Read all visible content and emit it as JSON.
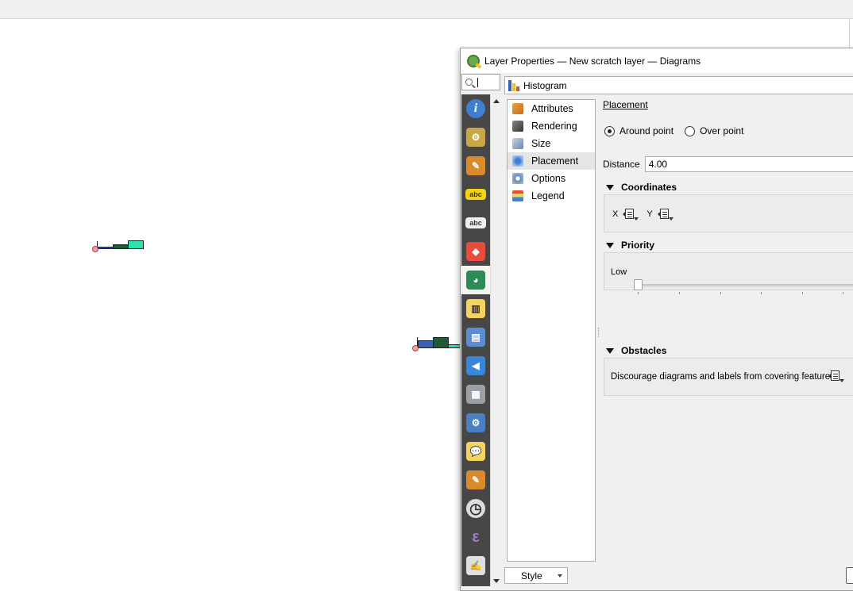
{
  "dialog": {
    "title": "Layer Properties — New scratch layer — Diagrams",
    "search_value": "",
    "diagram_type": "Histogram",
    "style_button": "Style"
  },
  "sidebar_icons": [
    {
      "name": "information-icon",
      "glyph": "i",
      "color": "#3f7fcf"
    },
    {
      "name": "source-icon",
      "glyph": "⚙",
      "color": "#c9a648"
    },
    {
      "name": "symbology-icon",
      "glyph": "✎",
      "color": "#d98b2b"
    },
    {
      "name": "labels-icon",
      "glyph": "abc",
      "color": "#f5d215"
    },
    {
      "name": "masks-icon",
      "glyph": "abc",
      "color": "#eeeeee"
    },
    {
      "name": "3d-view-icon",
      "glyph": "◆",
      "color": "#e94b3c"
    },
    {
      "name": "diagrams-icon",
      "glyph": "◕",
      "color": "#2e8b57"
    },
    {
      "name": "fields-icon",
      "glyph": "▥",
      "color": "#f4d35e"
    },
    {
      "name": "attributes-form-icon",
      "glyph": "▤",
      "color": "#5b8dcf"
    },
    {
      "name": "joins-icon",
      "glyph": "◀",
      "color": "#3a86d9"
    },
    {
      "name": "auxiliary-storage-icon",
      "glyph": "▦",
      "color": "#9aa0a6"
    },
    {
      "name": "actions-icon",
      "glyph": "⚙",
      "color": "#4a7fc1"
    },
    {
      "name": "display-icon",
      "glyph": "💬",
      "color": "#f4d35e"
    },
    {
      "name": "rendering-icon",
      "glyph": "✎",
      "color": "#d98b2b"
    },
    {
      "name": "temporal-icon",
      "glyph": "◷",
      "color": "#dddddd"
    },
    {
      "name": "variables-icon",
      "glyph": "ε",
      "color": "#7b4a9e"
    },
    {
      "name": "metadata-icon",
      "glyph": "✍",
      "color": "#e0e0e0"
    }
  ],
  "subnav": [
    {
      "label": "Attributes",
      "icon": "attributes-brush-icon"
    },
    {
      "label": "Rendering",
      "icon": "rendering-brush-icon"
    },
    {
      "label": "Size",
      "icon": "size-icon"
    },
    {
      "label": "Placement",
      "icon": "placement-move-icon"
    },
    {
      "label": "Options",
      "icon": "options-gear-icon"
    },
    {
      "label": "Legend",
      "icon": "legend-icon"
    }
  ],
  "placement": {
    "heading": "Placement",
    "option_around": "Around point",
    "option_over": "Over point",
    "distance_label": "Distance",
    "distance_value": "4.00"
  },
  "coordinates": {
    "heading": "Coordinates",
    "x_label": "X",
    "y_label": "Y"
  },
  "priority": {
    "heading": "Priority",
    "low_label": "Low"
  },
  "obstacles": {
    "heading": "Obstacles",
    "text": "Discourage diagrams and labels from covering features"
  },
  "colors": {
    "bar_blue": "#3a5fb8",
    "bar_green": "#1e5b32",
    "bar_teal": "#2ee0b0"
  }
}
